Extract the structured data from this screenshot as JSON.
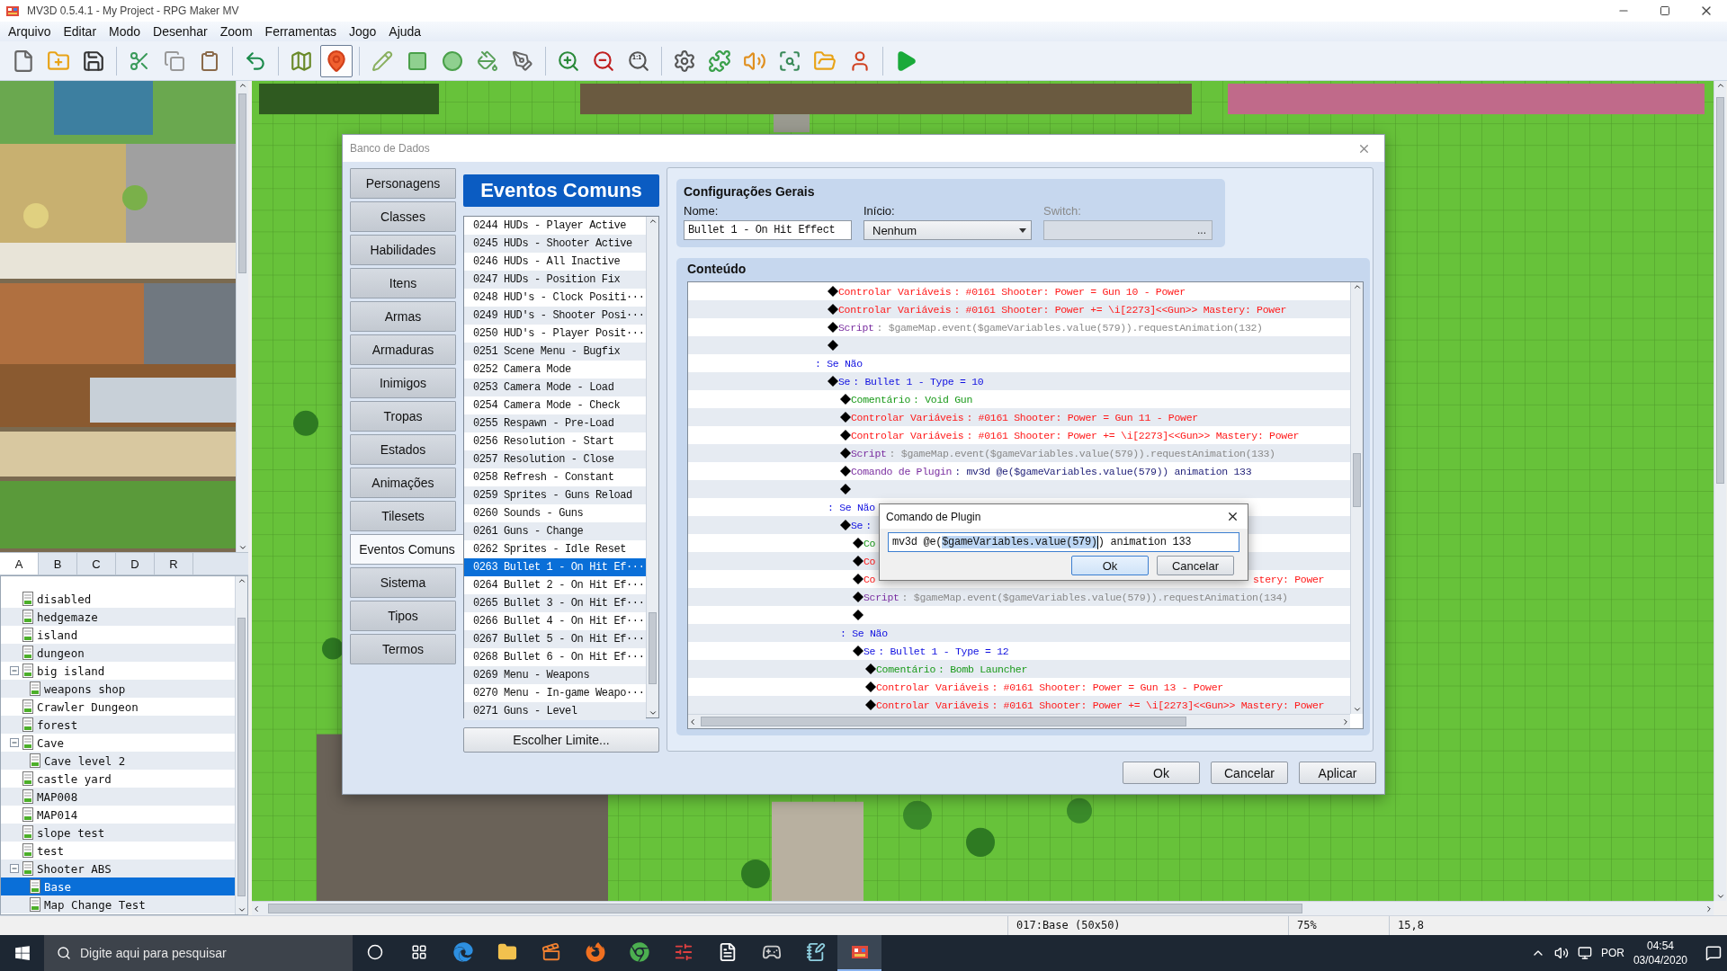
{
  "window": {
    "title": "MV3D 0.5.4.1 - My Project - RPG Maker MV"
  },
  "menu": [
    "Arquivo",
    "Editar",
    "Modo",
    "Desenhar",
    "Zoom",
    "Ferramentas",
    "Jogo",
    "Ajuda"
  ],
  "toolbar": [
    [
      {
        "selected": false
      },
      {
        "selected": false
      },
      {
        "selected": false
      }
    ],
    [
      {
        "selected": false
      },
      {
        "selected": false
      },
      {
        "selected": false
      }
    ],
    [
      {
        "selected": false
      }
    ],
    [
      {
        "selected": false
      },
      {
        "selected": true
      }
    ],
    [
      {
        "selected": false
      },
      {
        "selected": false
      },
      {
        "selected": false
      },
      {
        "selected": false
      },
      {
        "selected": false
      }
    ],
    [
      {
        "selected": false
      },
      {
        "selected": false
      },
      {
        "selected": false,
        "label": "1:1"
      }
    ],
    [
      {
        "selected": false
      },
      {
        "selected": false
      },
      {
        "selected": false
      },
      {
        "selected": false
      },
      {
        "selected": false
      },
      {
        "selected": false
      }
    ],
    [
      {
        "selected": false
      }
    ]
  ],
  "tile_tabs": [
    {
      "label": "A",
      "selected": true
    },
    {
      "label": "B",
      "selected": false
    },
    {
      "label": "C",
      "selected": false
    },
    {
      "label": "D",
      "selected": false
    },
    {
      "label": "R",
      "selected": false
    }
  ],
  "map_tree": [
    {
      "name": "disabled",
      "selected": false
    },
    {
      "name": "hedgemaze",
      "selected": false
    },
    {
      "name": "island",
      "selected": false
    },
    {
      "name": "dungeon",
      "selected": false
    },
    {
      "name": "big island",
      "selected": false,
      "expanded": true,
      "children": [
        {
          "name": "weapons shop",
          "selected": false
        }
      ]
    },
    {
      "name": "Crawler Dungeon",
      "selected": false
    },
    {
      "name": "forest",
      "selected": false
    },
    {
      "name": "Cave",
      "selected": false,
      "expanded": true,
      "children": [
        {
          "name": "Cave level 2",
          "selected": false
        }
      ]
    },
    {
      "name": "castle yard",
      "selected": false
    },
    {
      "name": "MAP008",
      "selected": false
    },
    {
      "name": "MAP014",
      "selected": false
    },
    {
      "name": "slope test",
      "selected": false
    },
    {
      "name": "test",
      "selected": false
    },
    {
      "name": "Shooter ABS",
      "selected": false,
      "expanded": true,
      "children": [
        {
          "name": "Base",
          "selected": true
        },
        {
          "name": "Map Change Test",
          "selected": false
        }
      ]
    }
  ],
  "database": {
    "title": "Banco de Dados",
    "tabs": [
      {
        "label": "Personagens",
        "selected": false
      },
      {
        "label": "Classes",
        "selected": false
      },
      {
        "label": "Habilidades",
        "selected": false
      },
      {
        "label": "Itens",
        "selected": false
      },
      {
        "label": "Armas",
        "selected": false
      },
      {
        "label": "Armaduras",
        "selected": false
      },
      {
        "label": "Inimigos",
        "selected": false
      },
      {
        "label": "Tropas",
        "selected": false
      },
      {
        "label": "Estados",
        "selected": false
      },
      {
        "label": "Animações",
        "selected": false
      },
      {
        "label": "Tilesets",
        "selected": false
      },
      {
        "label": "Eventos Comuns",
        "selected": true
      },
      {
        "label": "Sistema",
        "selected": false
      },
      {
        "label": "Tipos",
        "selected": false
      },
      {
        "label": "Termos",
        "selected": false
      }
    ],
    "list_title": "Eventos Comuns",
    "events": [
      {
        "label": "0244 HUDs - Player Active",
        "selected": false
      },
      {
        "label": "0245 HUDs - Shooter Active",
        "selected": false
      },
      {
        "label": "0246 HUDs - All Inactive",
        "selected": false
      },
      {
        "label": "0247 HUDs - Position Fix",
        "selected": false
      },
      {
        "label": "0248 HUD's - Clock Positi···",
        "selected": false
      },
      {
        "label": "0249 HUD's - Shooter Posi···",
        "selected": false
      },
      {
        "label": "0250 HUD's - Player Posit···",
        "selected": false
      },
      {
        "label": "0251 Scene Menu - Bugfix",
        "selected": false
      },
      {
        "label": "0252 Camera Mode",
        "selected": false
      },
      {
        "label": "0253 Camera Mode - Load",
        "selected": false
      },
      {
        "label": "0254 Camera Mode - Check",
        "selected": false
      },
      {
        "label": "0255 Respawn - Pre-Load",
        "selected": false
      },
      {
        "label": "0256 Resolution - Start",
        "selected": false
      },
      {
        "label": "0257 Resolution - Close",
        "selected": false
      },
      {
        "label": "0258 Refresh - Constant",
        "selected": false
      },
      {
        "label": "0259 Sprites - Guns Reload",
        "selected": false
      },
      {
        "label": "0260 Sounds - Guns",
        "selected": false
      },
      {
        "label": "0261 Guns - Change",
        "selected": false
      },
      {
        "label": "0262 Sprites - Idle Reset",
        "selected": false
      },
      {
        "label": "0263 Bullet 1 - On Hit Ef···",
        "selected": true
      },
      {
        "label": "0264 Bullet 2 - On Hit Ef···",
        "selected": false
      },
      {
        "label": "0265 Bullet 3 - On Hit Ef···",
        "selected": false
      },
      {
        "label": "0266 Bullet 4 - On Hit Ef···",
        "selected": false
      },
      {
        "label": "0267 Bullet 5 - On Hit Ef···",
        "selected": false
      },
      {
        "label": "0268 Bullet 6 - On Hit Ef···",
        "selected": false
      },
      {
        "label": "0269 Menu - Weapons",
        "selected": false
      },
      {
        "label": "0270 Menu - In-game Weapo···",
        "selected": false
      },
      {
        "label": "0271 Guns - Level",
        "selected": false
      }
    ],
    "limit_button": "Escolher Limite...",
    "general": {
      "title": "Configurações Gerais",
      "name_label": "Nome:",
      "name_value": "Bullet 1 - On Hit Effect",
      "trigger_label": "Início:",
      "trigger_value": "Nenhum",
      "switch_label": "Switch:",
      "switch_button": "...",
      "switch_disabled": true
    },
    "content": {
      "title": "Conteúdo",
      "rows": [
        {
          "kind": "group",
          "children": [
            {
              "kind": "variable",
              "name": "Controlar Variáveis",
              "param": ": #0161 Shooter: Power = Gun 10 - Power"
            },
            {
              "kind": "variable",
              "name": "Controlar Variáveis",
              "param": ": #0161 Shooter: Power += \\i[2273]<<Gun>> Mastery: Power"
            },
            {
              "kind": "script",
              "name": "Script",
              "param": ": $gameMap.event($gameVariables.value(579)).requestAnimation(132)"
            },
            {
              "kind": "blank"
            }
          ]
        },
        {
          "kind": "else",
          "name": ": Se Não",
          "children": [
            {
              "kind": "if",
              "name": "Se",
              "param": ": Bullet 1 - Type = 10",
              "children": [
                {
                  "kind": "comment",
                  "name": "Comentário",
                  "param": ": Void Gun"
                },
                {
                  "kind": "variable",
                  "name": "Controlar Variáveis",
                  "param": ": #0161 Shooter: Power = Gun 11 - Power"
                },
                {
                  "kind": "variable",
                  "name": "Controlar Variáveis",
                  "param": ": #0161 Shooter: Power += \\i[2273]<<Gun>> Mastery: Power"
                },
                {
                  "kind": "script",
                  "name": "Script",
                  "param": ": $gameMap.event($gameVariables.value(579)).requestAnimation(133)"
                },
                {
                  "kind": "plugin",
                  "name": "Comando de Plugin",
                  "param": ": mv3d @e($gameVariables.value(579)) animation 133"
                },
                {
                  "kind": "blank"
                }
              ]
            },
            {
              "kind": "else",
              "name": ": Se Não",
              "children": [
                {
                  "kind": "if",
                  "name": "Se",
                  "param": ":",
                  "children": [
                    {
                      "kind": "comment",
                      "name": "Co"
                    },
                    {
                      "kind": "variable",
                      "name": "Co"
                    },
                    {
                      "kind": "variable",
                      "name": "Co",
                      "tail": "stery: Power"
                    },
                    {
                      "kind": "script",
                      "name": "Script",
                      "param": ": $gameMap.event($gameVariables.value(579)).requestAnimation(134)"
                    },
                    {
                      "kind": "blank"
                    }
                  ]
                },
                {
                  "kind": "else",
                  "name": ": Se Não",
                  "children": [
                    {
                      "kind": "if",
                      "name": "Se",
                      "param": ": Bullet 1 - Type = 12",
                      "children": [
                        {
                          "kind": "comment",
                          "name": "Comentário",
                          "param": ": Bomb Launcher"
                        },
                        {
                          "kind": "variable",
                          "name": "Controlar Variáveis",
                          "param": ": #0161 Shooter: Power = Gun 13 - Power"
                        },
                        {
                          "kind": "variable",
                          "name": "Controlar Variáveis",
                          "param": ": #0161 Shooter: Power += \\i[2273]<<Gun>> Mastery: Power"
                        }
                      ]
                    }
                  ]
                }
              ]
            }
          ]
        }
      ]
    },
    "buttons": [
      "Ok",
      "Cancelar",
      "Aplicar"
    ]
  },
  "plugin_dialog": {
    "title": "Comando de Plugin",
    "value_parts": [
      {
        "text": "mv3d @e(",
        "selected": false
      },
      {
        "text": "$gameVariables.value(579)",
        "selected": true
      },
      {
        "text": ") animation 133",
        "selected": false
      }
    ],
    "buttons": [
      {
        "label": "Ok",
        "default": true
      },
      {
        "label": "Cancelar",
        "default": false
      }
    ]
  },
  "status_bar": [
    "017:Base (50x50)",
    "75%",
    "15,8"
  ],
  "taskbar": {
    "search_placeholder": "Digite aqui para pesquisar",
    "apps": [
      {
        "active": false
      },
      {
        "active": false
      },
      {
        "active": false
      },
      {
        "active": false
      },
      {
        "active": false
      },
      {
        "active": false
      },
      {
        "active": false
      },
      {
        "active": false
      },
      {
        "active": false
      },
      {
        "active": true
      }
    ],
    "language": "POR",
    "time": "04:54",
    "date": "03/04/2020"
  }
}
